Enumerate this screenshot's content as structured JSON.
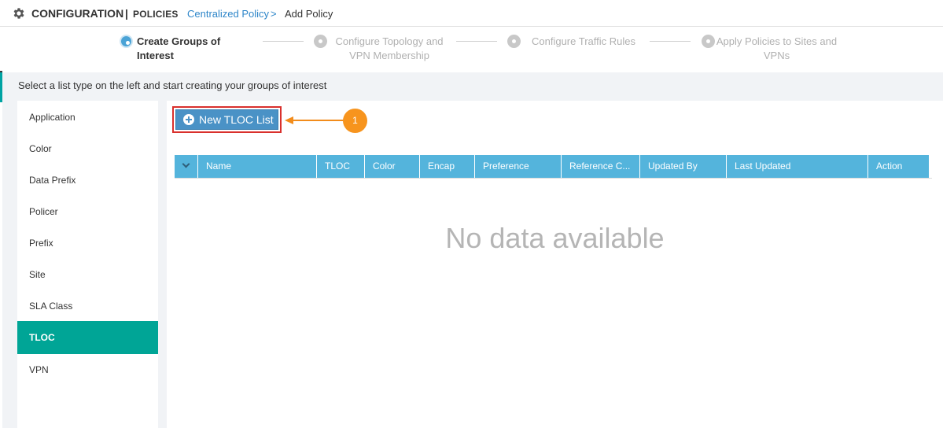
{
  "header": {
    "title": "CONFIGURATION",
    "separator": "|",
    "section": "POLICIES",
    "breadcrumb_link": "Centralized Policy",
    "breadcrumb_arrow": ">",
    "breadcrumb_current": "Add Policy"
  },
  "wizard": {
    "steps": [
      {
        "line1": "Create Groups of Interest",
        "line2": "",
        "state": "active"
      },
      {
        "line1": "Configure Topology and",
        "line2": "VPN Membership",
        "state": "inactive"
      },
      {
        "line1": "Configure Traffic Rules",
        "line2": "",
        "state": "inactive"
      },
      {
        "line1": "Apply Policies to Sites and",
        "line2": "VPNs",
        "state": "inactive"
      }
    ]
  },
  "instruction": "Select a list type on the left and start creating your groups of interest",
  "sidebar": {
    "items": [
      {
        "label": "Application"
      },
      {
        "label": "Color"
      },
      {
        "label": "Data Prefix"
      },
      {
        "label": "Policer"
      },
      {
        "label": "Prefix"
      },
      {
        "label": "Site"
      },
      {
        "label": "SLA Class"
      },
      {
        "label": "TLOC"
      },
      {
        "label": "VPN"
      }
    ],
    "selected": "TLOC"
  },
  "toolbar": {
    "new_button_label": "New TLOC List",
    "callout_number": "1"
  },
  "table": {
    "columns": [
      "Name",
      "TLOC",
      "Color",
      "Encap",
      "Preference",
      "Reference C...",
      "Updated By",
      "Last Updated",
      "Action"
    ],
    "empty_message": "No data available"
  },
  "colors": {
    "accent_teal": "#00a596",
    "header_blue": "#54b4dc",
    "button_blue": "#4a92c6",
    "link_blue": "#2e86c9",
    "callout_orange": "#f7941d",
    "highlight_red": "#d9302c"
  },
  "icons": {
    "header": "gear-icon",
    "button": "plus-circle-icon",
    "table_toggle": "chevron-down-icon"
  }
}
